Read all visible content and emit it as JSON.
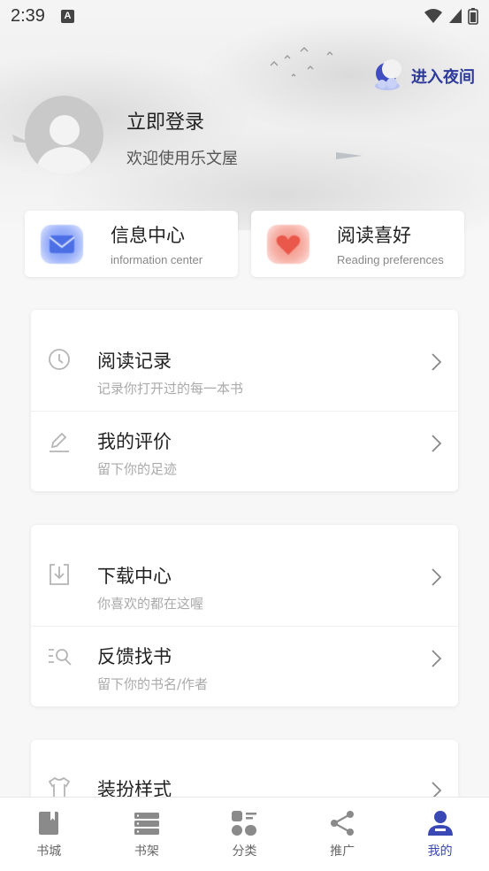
{
  "status": {
    "time": "2:39",
    "a_badge": "A"
  },
  "header": {
    "night_mode_label": "进入夜间",
    "login_title": "立即登录",
    "login_subtitle": "欢迎使用乐文屋"
  },
  "quick_cards": [
    {
      "title": "信息中心",
      "subtitle": "information center",
      "icon": "message-icon",
      "color": "#4f72e8"
    },
    {
      "title": "阅读喜好",
      "subtitle": "Reading preferences",
      "icon": "heart-icon",
      "color": "#ee6a5c"
    }
  ],
  "groups": [
    {
      "rows": [
        {
          "title": "阅读记录",
          "subtitle": "记录你打开过的每一本书",
          "icon": "clock-icon"
        },
        {
          "title": "我的评价",
          "subtitle": "留下你的足迹",
          "icon": "edit-icon"
        }
      ]
    },
    {
      "rows": [
        {
          "title": "下载中心",
          "subtitle": "你喜欢的都在这喔",
          "icon": "download-icon"
        },
        {
          "title": "反馈找书",
          "subtitle": "留下你的书名/作者",
          "icon": "search-list-icon"
        }
      ]
    },
    {
      "rows": [
        {
          "title": "装扮样式",
          "subtitle": "",
          "icon": "shirt-icon"
        }
      ]
    }
  ],
  "tabs": [
    {
      "label": "书城",
      "icon": "book-icon",
      "active": false
    },
    {
      "label": "书架",
      "icon": "bookshelf-icon",
      "active": false
    },
    {
      "label": "分类",
      "icon": "category-icon",
      "active": false
    },
    {
      "label": "推广",
      "icon": "share-icon",
      "active": false
    },
    {
      "label": "我的",
      "icon": "user-icon",
      "active": true
    }
  ],
  "colors": {
    "accent": "#3a48b6",
    "night_label": "#2d3a9a"
  }
}
